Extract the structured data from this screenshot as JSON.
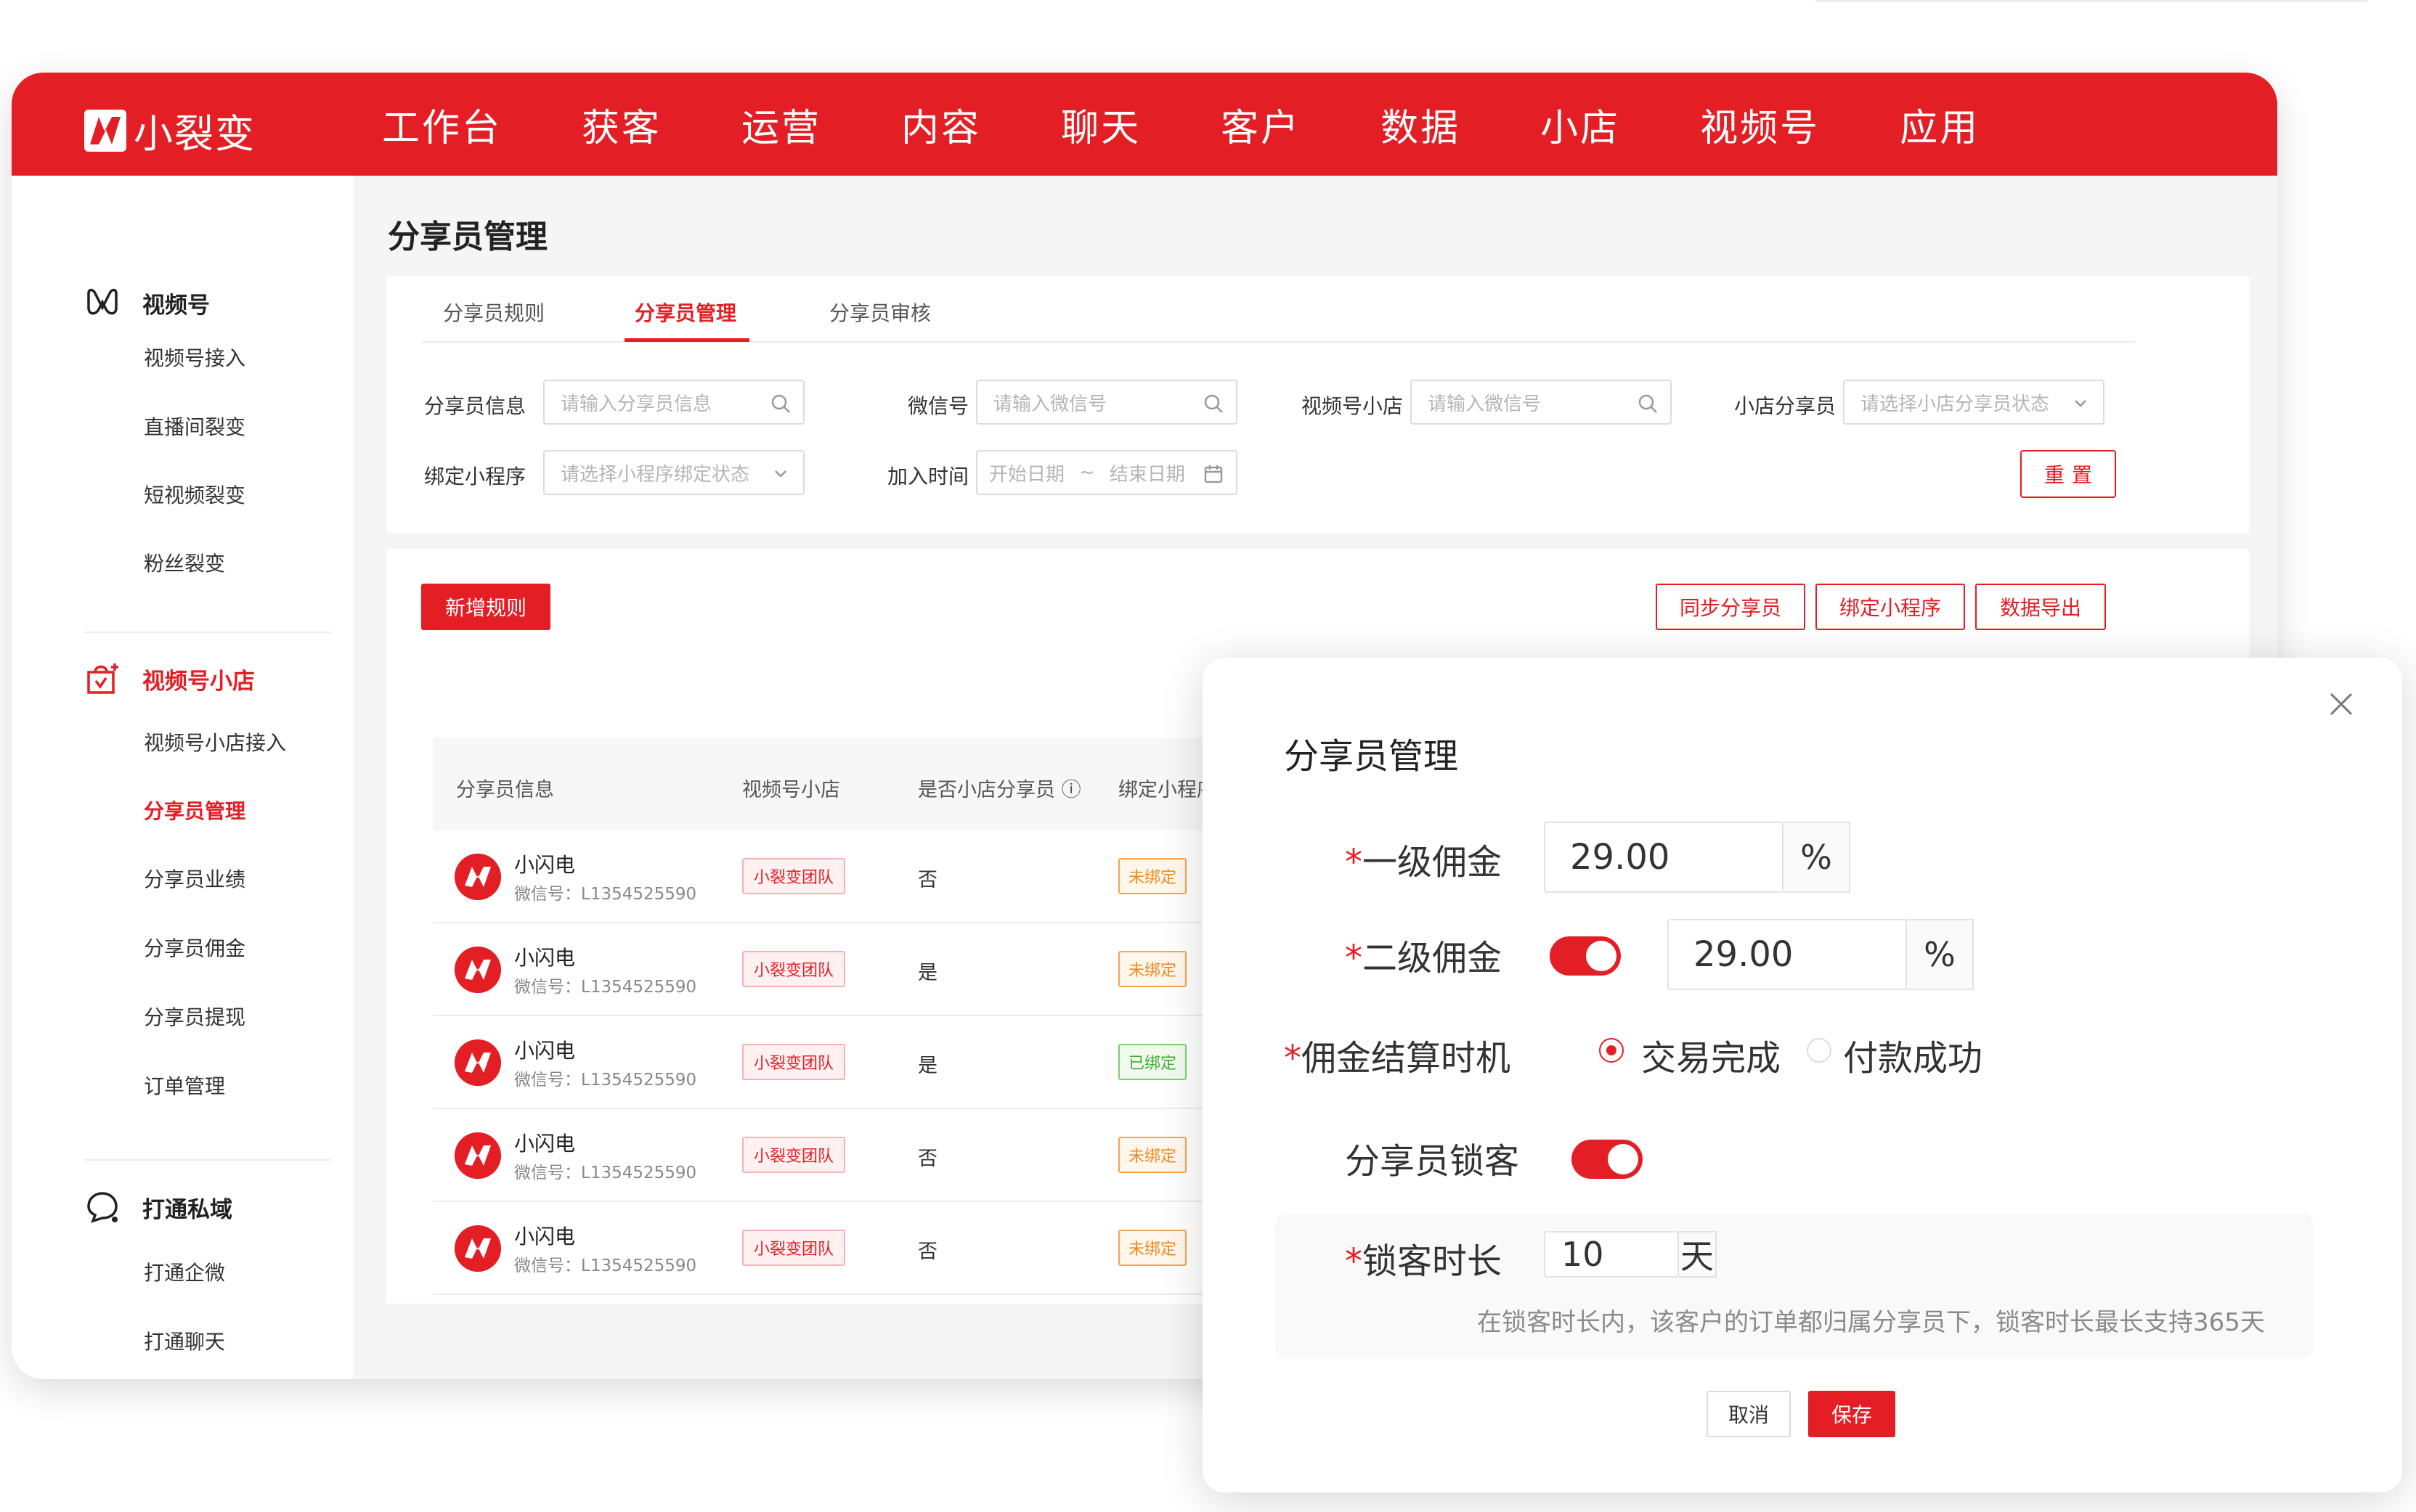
{
  "app": {
    "name": "小裂变"
  },
  "nav": [
    "工作台",
    "获客",
    "运营",
    "内容",
    "聊天",
    "客户",
    "数据",
    "小店",
    "视频号",
    "应用"
  ],
  "sidebar": {
    "groups": [
      {
        "label": "视频号",
        "icon": "video-channel-icon",
        "items": [
          "视频号接入",
          "直播间裂变",
          "短视频裂变",
          "粉丝裂变"
        ]
      },
      {
        "label": "视频号小店",
        "icon": "shop-bag-icon",
        "items": [
          "视频号小店接入",
          "分享员管理",
          "分享员业绩",
          "分享员佣金",
          "分享员提现",
          "订单管理"
        ]
      },
      {
        "label": "打通私域",
        "icon": "chat-bubble-icon",
        "items": [
          "打通企微",
          "打通聊天"
        ]
      }
    ],
    "active_item": "分享员管理"
  },
  "page": {
    "title": "分享员管理"
  },
  "tabs": [
    "分享员规则",
    "分享员管理",
    "分享员审核"
  ],
  "filters": {
    "sharer_info": {
      "label": "分享员信息",
      "placeholder": "请输入分享员信息"
    },
    "wechat": {
      "label": "微信号",
      "placeholder": "请输入微信号"
    },
    "shop": {
      "label": "视频号小店",
      "placeholder": "请输入微信号"
    },
    "shop_sharer": {
      "label": "小店分享员",
      "placeholder": "请选择小店分享员状态"
    },
    "mini_program": {
      "label": "绑定小程序",
      "placeholder": "请选择小程序绑定状态"
    },
    "join_time": {
      "label": "加入时间",
      "start": "开始日期",
      "sep": "~",
      "end": "结束日期"
    },
    "reset_label": "重置"
  },
  "actions": {
    "add_rule": "新增规则",
    "sync": "同步分享员",
    "bind_mini": "绑定小程序",
    "export": "数据导出"
  },
  "table": {
    "columns": [
      "分享员信息",
      "视频号小店",
      "是否小店分享员 ⓘ",
      "绑定小程序"
    ],
    "rows": [
      {
        "name": "小闪电",
        "wechat": "微信号：L1354525590",
        "shop": "小裂变团队",
        "is_sharer": "否",
        "bind": "未绑定"
      },
      {
        "name": "小闪电",
        "wechat": "微信号：L1354525590",
        "shop": "小裂变团队",
        "is_sharer": "是",
        "bind": "未绑定"
      },
      {
        "name": "小闪电",
        "wechat": "微信号：L1354525590",
        "shop": "小裂变团队",
        "is_sharer": "是",
        "bind": "已绑定"
      },
      {
        "name": "小闪电",
        "wechat": "微信号：L1354525590",
        "shop": "小裂变团队",
        "is_sharer": "否",
        "bind": "未绑定"
      },
      {
        "name": "小闪电",
        "wechat": "微信号：L1354525590",
        "shop": "小裂变团队",
        "is_sharer": "否",
        "bind": "未绑定"
      }
    ]
  },
  "modal": {
    "title": "分享员管理",
    "required_mark": "*",
    "level1": {
      "label": "一级佣金",
      "value": "29.00",
      "unit": "%"
    },
    "level2": {
      "label": "二级佣金",
      "value": "29.00",
      "unit": "%",
      "enabled": true
    },
    "settle": {
      "label": "佣金结算时机",
      "options": [
        "交易完成",
        "付款成功"
      ],
      "selected": "交易完成"
    },
    "lock": {
      "label": "分享员锁客",
      "enabled": true
    },
    "lock_duration": {
      "label": "锁客时长",
      "value": "10",
      "unit": "天"
    },
    "hint": "在锁客时长内，该客户的订单都归属分享员下，锁客时长最长支持365天",
    "cancel": "取消",
    "save": "保存"
  },
  "colors": {
    "brand": "#e31e24",
    "unbound": "#f08a1b",
    "bound": "#3fae32"
  }
}
